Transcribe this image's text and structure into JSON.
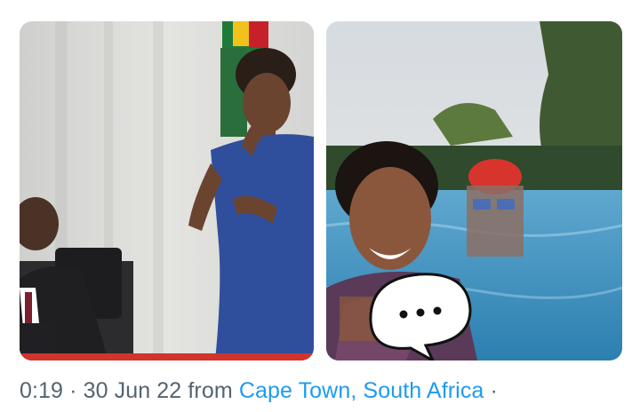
{
  "tweet": {
    "meta": {
      "time": "0:19",
      "separator": " · ",
      "date": "30 Jun 22",
      "from_prefix": " from ",
      "location": "Cape Town, South Africa",
      "trailing_separator": " ·"
    },
    "media": [
      {
        "icon": "photo-sign-language-interpreter"
      },
      {
        "icon": "photo-selfie-pool",
        "overlay_icon": "speech-bubble-ellipsis-icon"
      }
    ]
  },
  "colors": {
    "link": "#1d9bf0",
    "meta_text": "#536471",
    "accent_bar": "#d0342c"
  }
}
